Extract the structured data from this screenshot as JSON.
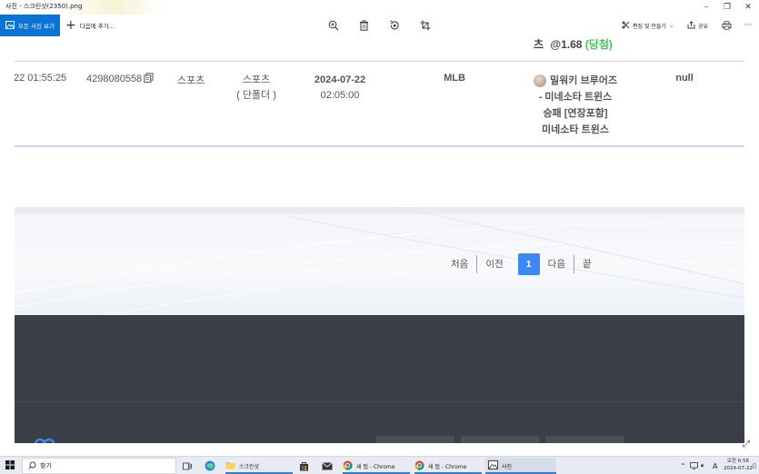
{
  "window": {
    "title": "사진 - 스크린샷(2350).png",
    "controls": [
      "minimize",
      "restore",
      "close"
    ]
  },
  "toolbar": {
    "all_photos_label": "모든 사진 보기",
    "add_to_label": "다음에 추가...",
    "edit_label": "편집 및 만들기",
    "share_label": "공유",
    "icons": [
      "zoom-in-icon",
      "delete-icon",
      "rotate-icon",
      "crop-icon",
      "edit-icon",
      "share-icon",
      "print-icon",
      "more-icon"
    ]
  },
  "bet_row": {
    "odds_prefix": "츠",
    "odds_value": "@1.68",
    "result": "(당첨)",
    "datetime_partial": "22 01:55:25",
    "bet_id": "4298080558",
    "category": "스포츠",
    "subcategory_line1": "스포츠",
    "subcategory_line2": "( 단폴더 )",
    "game_date": "2024-07-22",
    "game_time": "02:05:00",
    "league": "MLB",
    "match_line1": "밀워키 브루어즈",
    "match_line2": "- 미네소타 트윈스",
    "match_line3": "승패 [연장포함]",
    "match_line4": "미네소타 트윈스",
    "extra": "null"
  },
  "pagination": {
    "first": "처음",
    "prev": "이전",
    "current": "1",
    "next": "다음",
    "last": "끝"
  },
  "taskbar": {
    "search_label": "찾기",
    "items": [
      {
        "label": "스크린샷",
        "icon": "folder-icon"
      },
      {
        "label": "새 탭 - Chrome",
        "icon": "chrome-icon"
      },
      {
        "label": "새 탭 - Chrome",
        "icon": "chrome-icon"
      },
      {
        "label": "사진",
        "icon": "photos-icon"
      }
    ],
    "tray_time": "오전 6:56",
    "tray_date": "2024-07-22",
    "ime": "A"
  },
  "colors": {
    "accent": "#0a74d4",
    "win_green": "#4cc05c",
    "pager_active": "#3f86f6",
    "footer": "#3a3f47"
  }
}
